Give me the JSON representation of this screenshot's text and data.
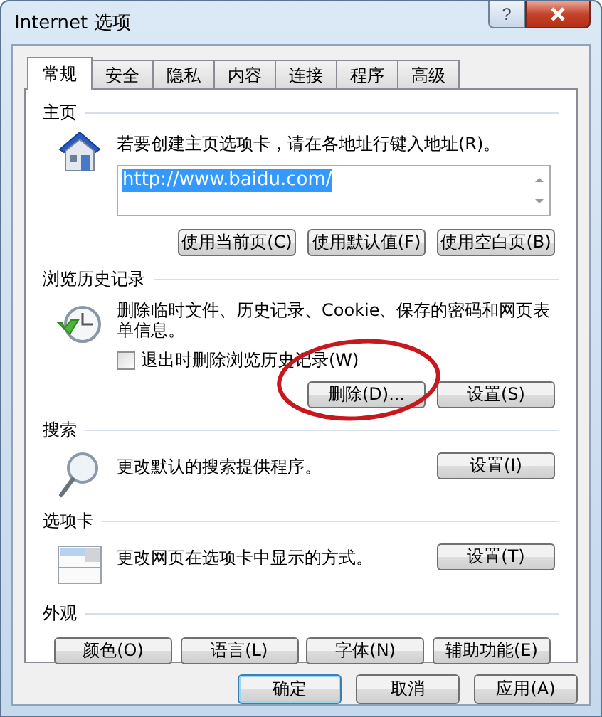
{
  "window": {
    "title": "Internet 选项",
    "help": "?"
  },
  "tabs": [
    {
      "label": "常规",
      "selected": true
    },
    {
      "label": "安全",
      "selected": false
    },
    {
      "label": "隐私",
      "selected": false
    },
    {
      "label": "内容",
      "selected": false
    },
    {
      "label": "连接",
      "selected": false
    },
    {
      "label": "程序",
      "selected": false
    },
    {
      "label": "高级",
      "selected": false
    }
  ],
  "sections": [
    {
      "kind": "home",
      "title": "主页",
      "description": "若要创建主页选项卡，请在各地址行键入地址(R)。",
      "url": "http://www.baidu.com/",
      "buttons": [
        "使用当前页(C)",
        "使用默认值(F)",
        "使用空白页(B)"
      ]
    },
    {
      "kind": "history",
      "title": "浏览历史记录",
      "description": "删除临时文件、历史记录、Cookie、保存的密码和网页表单信息。",
      "checkbox": {
        "label": "退出时删除浏览历史记录(W)",
        "checked": false
      },
      "buttons": [
        "删除(D)...",
        "设置(S)"
      ]
    },
    {
      "kind": "search",
      "title": "搜索",
      "description": "更改默认的搜索提供程序。",
      "buttons": [
        "设置(I)"
      ]
    },
    {
      "kind": "tabs",
      "title": "选项卡",
      "description": "更改网页在选项卡中显示的方式。",
      "buttons": [
        "设置(T)"
      ]
    },
    {
      "kind": "appearance",
      "title": "外观",
      "buttons": [
        "颜色(O)",
        "语言(L)",
        "字体(N)",
        "辅助功能(E)"
      ]
    }
  ],
  "footer_buttons": [
    {
      "label": "确定",
      "default": true
    },
    {
      "label": "取消",
      "default": false
    },
    {
      "label": "应用(A)",
      "default": false
    }
  ]
}
